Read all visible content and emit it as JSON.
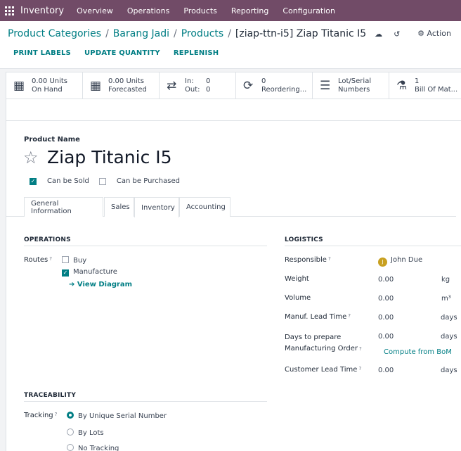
{
  "nav": {
    "app": "Inventory",
    "menus": [
      "Overview",
      "Operations",
      "Products",
      "Reporting",
      "Configuration"
    ]
  },
  "breadcrumb": {
    "items": [
      "Product Categories",
      "Barang Jadi",
      "Products"
    ],
    "current": "[ziap-ttn-i5] Ziap Titanic I5"
  },
  "action_label": "Action",
  "buttons": [
    "PRINT LABELS",
    "UPDATE QUANTITY",
    "REPLENISH"
  ],
  "stats": {
    "on_hand_value": "0.00 Units",
    "on_hand_label": "On Hand",
    "forecast_value": "0.00 Units",
    "forecast_label": "Forecasted",
    "in_label": "In:",
    "in_value": "0",
    "out_label": "Out:",
    "out_value": "0",
    "reorder_value": "0",
    "reorder_label": "Reordering...",
    "lot_line1": "Lot/Serial",
    "lot_line2": "Numbers",
    "bom_value": "1",
    "bom_label": "Bill Of Mat..."
  },
  "product": {
    "name_label": "Product Name",
    "name": "Ziap Titanic I5",
    "can_be_sold_label": "Can be Sold",
    "can_be_sold": true,
    "can_be_purchased_label": "Can be Purchased",
    "can_be_purchased": false
  },
  "tabs": [
    "General Information",
    "Sales",
    "Inventory",
    "Accounting"
  ],
  "active_tab": "Inventory",
  "operations": {
    "title": "OPERATIONS",
    "routes_label": "Routes",
    "route_buy": "Buy",
    "route_manufacture": "Manufacture",
    "view_diagram": "View Diagram"
  },
  "logistics": {
    "title": "LOGISTICS",
    "responsible_label": "Responsible",
    "responsible_initial": "J",
    "responsible": "John Due",
    "weight_label": "Weight",
    "weight": "0.00",
    "weight_unit": "kg",
    "volume_label": "Volume",
    "volume": "0.00",
    "volume_unit": "m³",
    "manuf_lead_label": "Manuf. Lead Time",
    "manuf_lead": "0.00",
    "manuf_lead_unit": "days",
    "days_prepare_label1": "Days to prepare",
    "days_prepare_label2": "Manufacturing Order",
    "days_prepare": "0.00",
    "days_prepare_unit": "days",
    "compute_bom": "Compute from BoM",
    "customer_lead_label": "Customer Lead Time",
    "customer_lead": "0.00",
    "customer_lead_unit": "days"
  },
  "traceability": {
    "title": "TRACEABILITY",
    "tracking_label": "Tracking",
    "options": [
      "By Unique Serial Number",
      "By Lots",
      "No Tracking"
    ],
    "selected": "By Unique Serial Number"
  },
  "colors": {
    "brand": "#714b67",
    "accent": "#017e84"
  }
}
